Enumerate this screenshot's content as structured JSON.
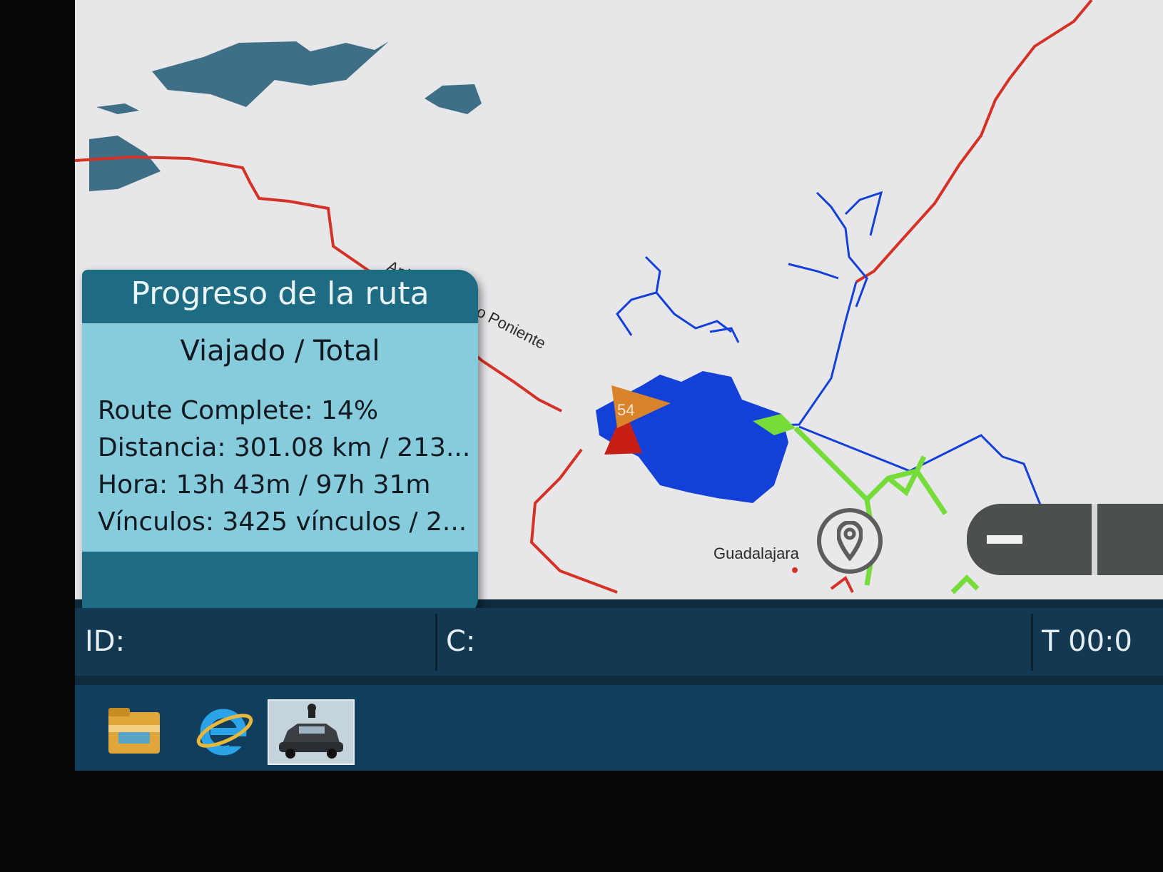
{
  "map": {
    "road_label": "Anillo Periférico Poniente",
    "city_label": "Guadalajara",
    "vehicle_marker_number": "54",
    "colors": {
      "background": "#e7e6e9",
      "water": "#3e6f86",
      "route_red": "#d43226",
      "coverage_blue": "#1340d8",
      "coverage_green": "#76dc39",
      "vehicle_marker": "#d9842a",
      "start_marker": "#c71f16"
    },
    "controls": {
      "location_icon": "location-pin-icon",
      "zoom_out_icon": "minus-icon"
    }
  },
  "progress_panel": {
    "title": "Progreso de la ruta",
    "subtitle": "Viajado / Total",
    "route_complete": "Route Complete: 14%",
    "distance": "Distancia: 301.08 km / 213...",
    "time": "Hora: 13h 43m / 97h 31m",
    "links": "Vínculos: 3425 vínculos / 2...",
    "route_complete_percent": 14
  },
  "status_bar": {
    "id_label": "ID:",
    "c_label": "C:",
    "time_label": "T 00:0"
  },
  "taskbar": {
    "items": [
      {
        "icon": "folder-icon",
        "name": "File Explorer"
      },
      {
        "icon": "internet-explorer-icon",
        "name": "Internet Explorer"
      },
      {
        "icon": "car-app-icon",
        "name": "Route App"
      }
    ]
  }
}
